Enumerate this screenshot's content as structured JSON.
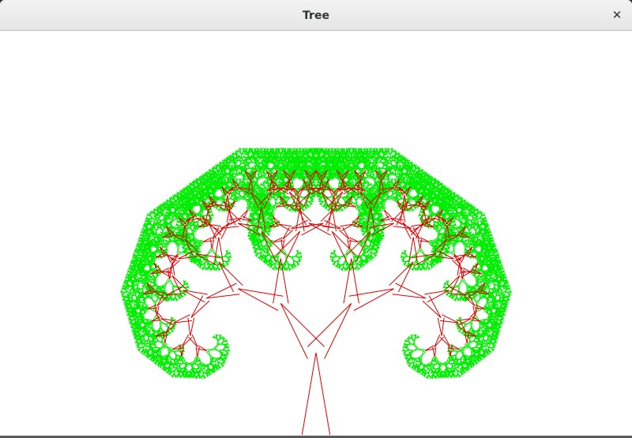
{
  "window": {
    "title": "Tree",
    "close_label": "✕"
  },
  "canvas": {
    "background": "#ffffff",
    "branch_color": "#e00000",
    "leaf_color": "#00ee00",
    "icon": "fractal-tree"
  }
}
